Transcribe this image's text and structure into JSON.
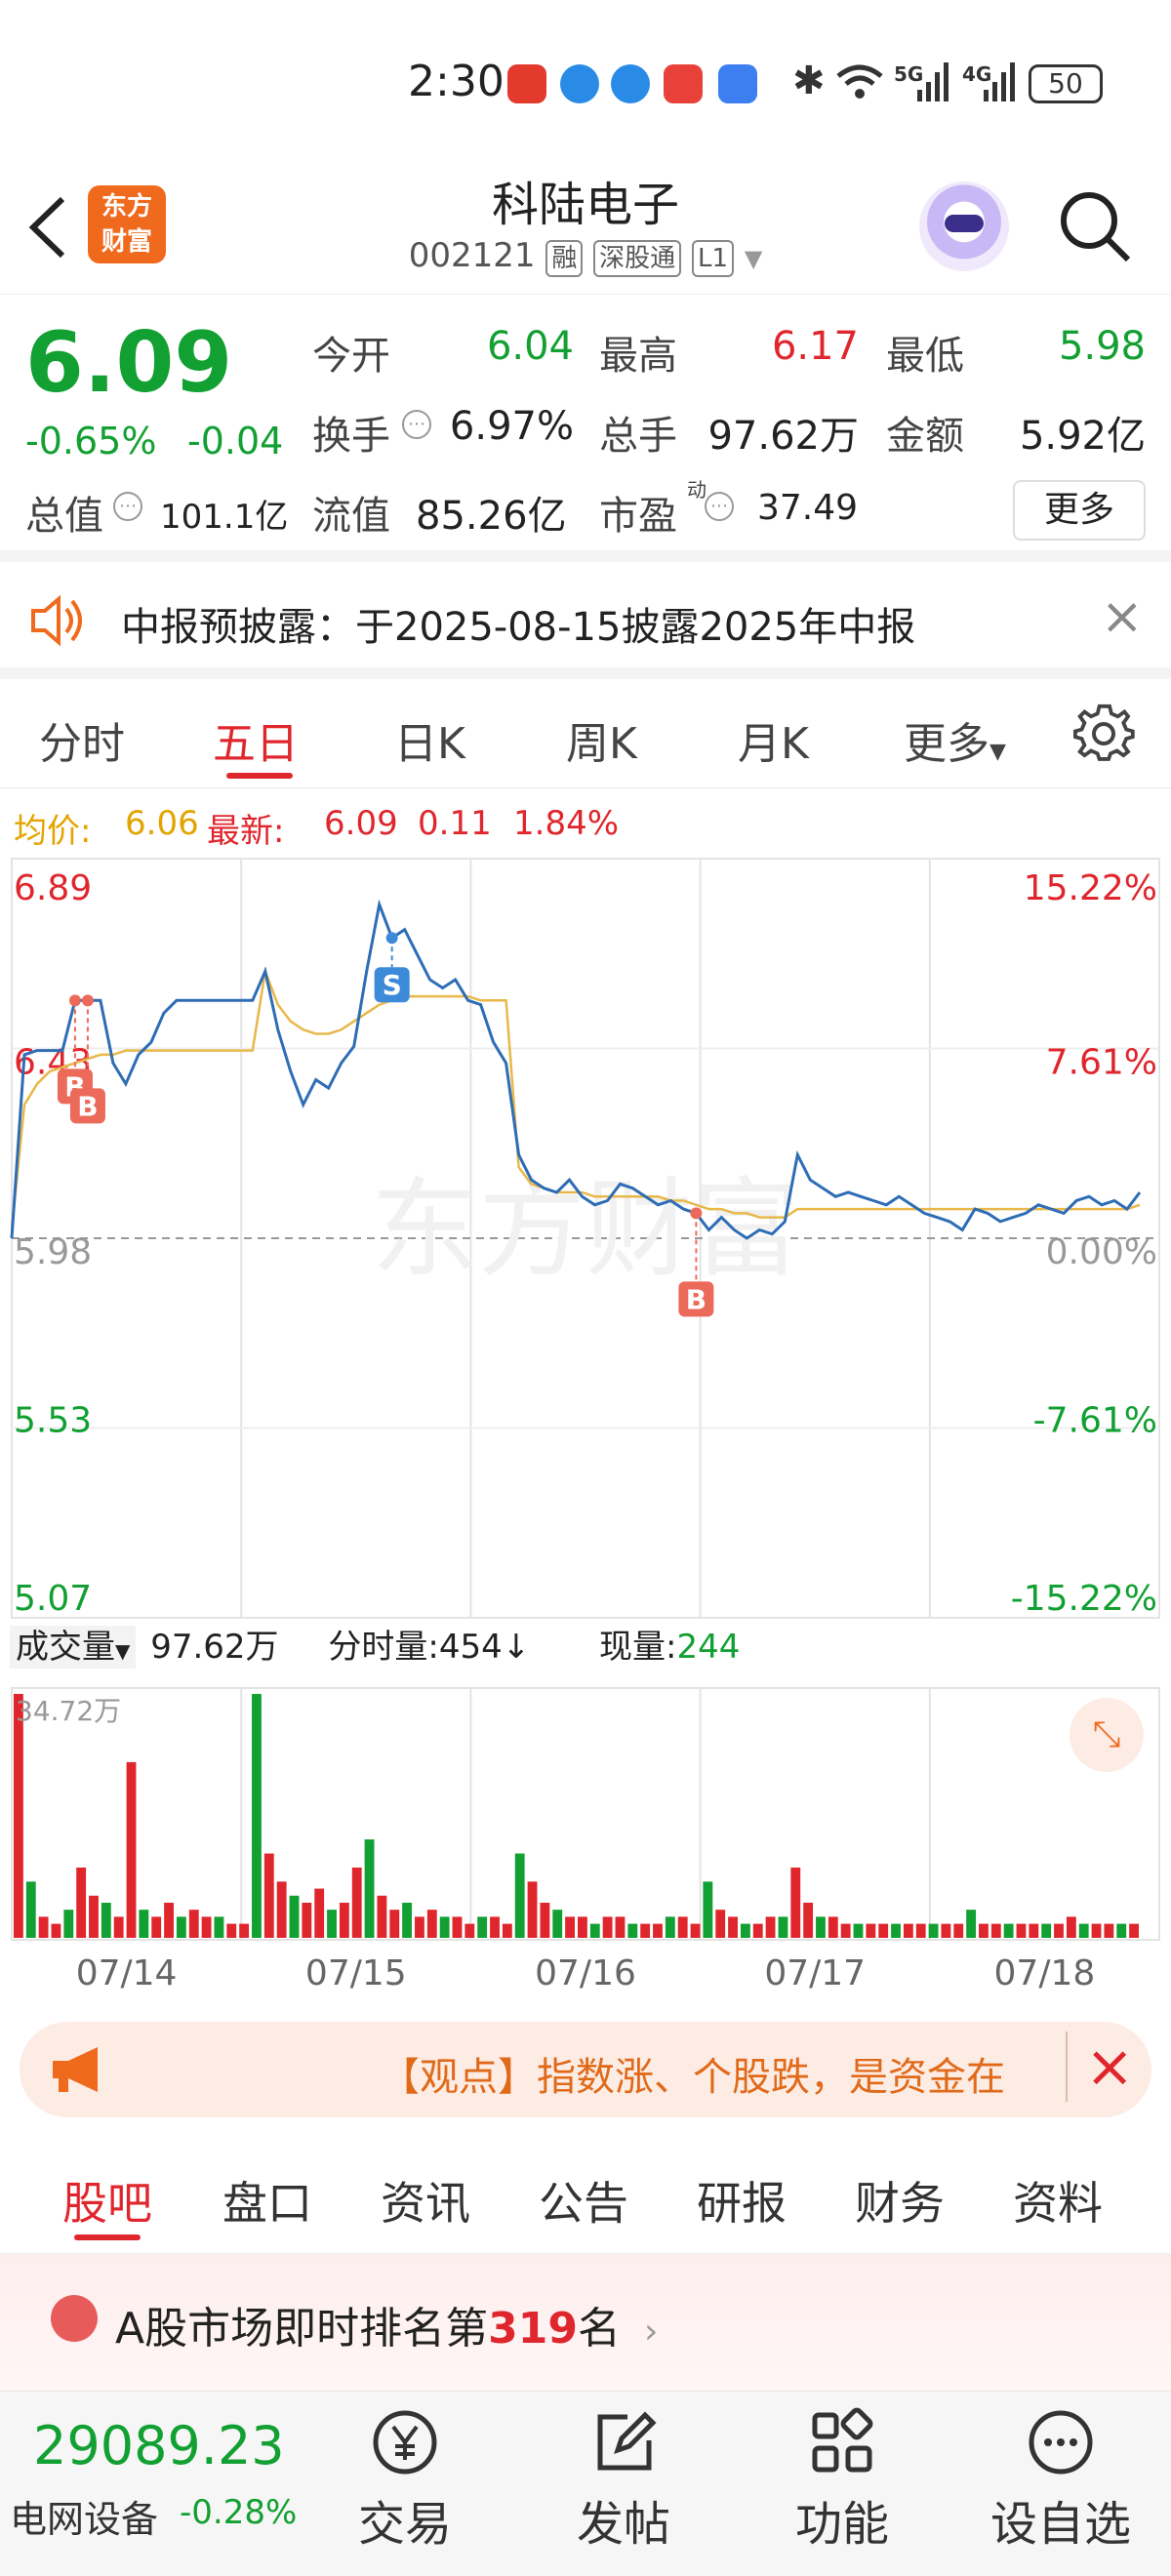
{
  "status_bar": {
    "time": "2:30",
    "battery": "50",
    "net1": "5G",
    "net2": "4G"
  },
  "header": {
    "title": "科陆电子",
    "code": "002121",
    "tag1": "融",
    "tag2": "深股通",
    "tag3": "L1",
    "logo_line1": "东方",
    "logo_line2": "财富"
  },
  "quote": {
    "price": "6.09",
    "change_pct": "-0.65%",
    "change": "-0.04",
    "open_label": "今开",
    "open": "6.04",
    "high_label": "最高",
    "high": "6.17",
    "low_label": "最低",
    "low": "5.98",
    "turnover_label": "换手",
    "turnover": "6.97%",
    "volume_label": "总手",
    "volume": "97.62万",
    "amount_label": "金额",
    "amount": "5.92亿",
    "mcap_label": "总值",
    "mcap": "101.1亿",
    "float_label": "流值",
    "float": "85.26亿",
    "pe_label": "市盈",
    "pe_sup": "动",
    "pe": "37.49",
    "more_button": "更多"
  },
  "notice": {
    "text": "中报预披露：于2025-08-15披露2025年中报"
  },
  "tabs": [
    "分时",
    "五日",
    "日K",
    "周K",
    "月K",
    "更多"
  ],
  "avg_line": {
    "avg_label": "均价:",
    "avg": "6.06",
    "latest_label": "最新:",
    "latest": "6.09",
    "chg": "0.11",
    "chg_pct": "1.84%"
  },
  "chart_data": {
    "type": "line",
    "y_left_ticks": [
      "6.89",
      "6.43",
      "5.98",
      "5.53",
      "5.07"
    ],
    "y_right_ticks": [
      "15.22%",
      "7.61%",
      "0.00%",
      "-7.61%",
      "-15.22%"
    ],
    "x_labels": [
      "07/14",
      "07/15",
      "07/16",
      "07/17",
      "07/18"
    ],
    "ylim": [
      5.07,
      6.89
    ],
    "prev_close": 5.98,
    "watermark": "东方财富",
    "series": [
      {
        "name": "price",
        "values": [
          5.98,
          6.42,
          6.43,
          6.43,
          6.43,
          6.55,
          6.55,
          6.55,
          6.4,
          6.35,
          6.42,
          6.45,
          6.52,
          6.55,
          6.55,
          6.55,
          6.55,
          6.55,
          6.55,
          6.55,
          6.62,
          6.48,
          6.38,
          6.3,
          6.36,
          6.34,
          6.4,
          6.44,
          6.62,
          6.78,
          6.7,
          6.72,
          6.66,
          6.6,
          6.58,
          6.6,
          6.55,
          6.54,
          6.45,
          6.4,
          6.18,
          6.12,
          6.1,
          6.09,
          6.12,
          6.08,
          6.06,
          6.07,
          6.11,
          6.1,
          6.08,
          6.06,
          6.07,
          6.05,
          6.04,
          6.0,
          6.03,
          6.0,
          5.98,
          6.0,
          5.99,
          6.02,
          6.18,
          6.12,
          6.1,
          6.08,
          6.09,
          6.08,
          6.07,
          6.06,
          6.08,
          6.06,
          6.04,
          6.03,
          6.02,
          6.0,
          6.05,
          6.04,
          6.02,
          6.03,
          6.04,
          6.06,
          6.05,
          6.04,
          6.07,
          6.08,
          6.06,
          6.07,
          6.05,
          6.09
        ]
      },
      {
        "name": "avg",
        "values": [
          6.0,
          6.3,
          6.35,
          6.38,
          6.39,
          6.4,
          6.41,
          6.42,
          6.42,
          6.43,
          6.43,
          6.43,
          6.43,
          6.43,
          6.43,
          6.43,
          6.43,
          6.43,
          6.43,
          6.43,
          6.62,
          6.54,
          6.5,
          6.48,
          6.47,
          6.47,
          6.48,
          6.5,
          6.52,
          6.54,
          6.55,
          6.56,
          6.56,
          6.56,
          6.56,
          6.56,
          6.56,
          6.55,
          6.55,
          6.55,
          6.15,
          6.11,
          6.1,
          6.09,
          6.09,
          6.09,
          6.08,
          6.08,
          6.08,
          6.08,
          6.08,
          6.08,
          6.07,
          6.07,
          6.06,
          6.05,
          6.05,
          6.04,
          6.04,
          6.03,
          6.03,
          6.03,
          6.05,
          6.05,
          6.05,
          6.05,
          6.05,
          6.05,
          6.05,
          6.05,
          6.05,
          6.05,
          6.05,
          6.05,
          6.05,
          6.05,
          6.05,
          6.05,
          6.05,
          6.05,
          6.05,
          6.05,
          6.05,
          6.05,
          6.05,
          6.05,
          6.05,
          6.05,
          6.05,
          6.06
        ]
      }
    ],
    "markers": [
      {
        "label": "B",
        "index": 5
      },
      {
        "label": "B",
        "index": 6
      },
      {
        "label": "S",
        "index": 30
      },
      {
        "label": "B",
        "index": 54
      }
    ]
  },
  "volume": {
    "label": "成交量",
    "total": "97.62万",
    "tick_label": "分时量:454↓",
    "now_label": "现量:",
    "now": "244",
    "max_label": "34.72万",
    "values": [
      34.7,
      8,
      3,
      2,
      4,
      10,
      6,
      5,
      3,
      25,
      4,
      3,
      5,
      3,
      4,
      3,
      3,
      2,
      2,
      34.7,
      12,
      8,
      6,
      5,
      7,
      4,
      5,
      10,
      14,
      6,
      4,
      5,
      3,
      4,
      3,
      3,
      2,
      3,
      3,
      2,
      12,
      8,
      5,
      4,
      3,
      3,
      2,
      3,
      3,
      2,
      2,
      2,
      3,
      3,
      2,
      8,
      4,
      3,
      2,
      2,
      3,
      3,
      10,
      5,
      3,
      3,
      2,
      2,
      2,
      2,
      2,
      2,
      2,
      2,
      2,
      2,
      4,
      2,
      2,
      2,
      2,
      2,
      2,
      2,
      3,
      2,
      2,
      2,
      2,
      2
    ]
  },
  "banner": {
    "text": "【观点】指数涨、个股跌，是资金在"
  },
  "sub_tabs": [
    "股吧",
    "盘口",
    "资讯",
    "公告",
    "研报",
    "财务",
    "资料"
  ],
  "rank": {
    "prefix": "A股市场即时排名第",
    "num": "319",
    "suffix": "名"
  },
  "bottom": {
    "index_value": "29089.23",
    "index_name": "电网设备",
    "index_chg": "-0.28%",
    "nav": [
      "交易",
      "发帖",
      "功能",
      "设自选"
    ]
  }
}
